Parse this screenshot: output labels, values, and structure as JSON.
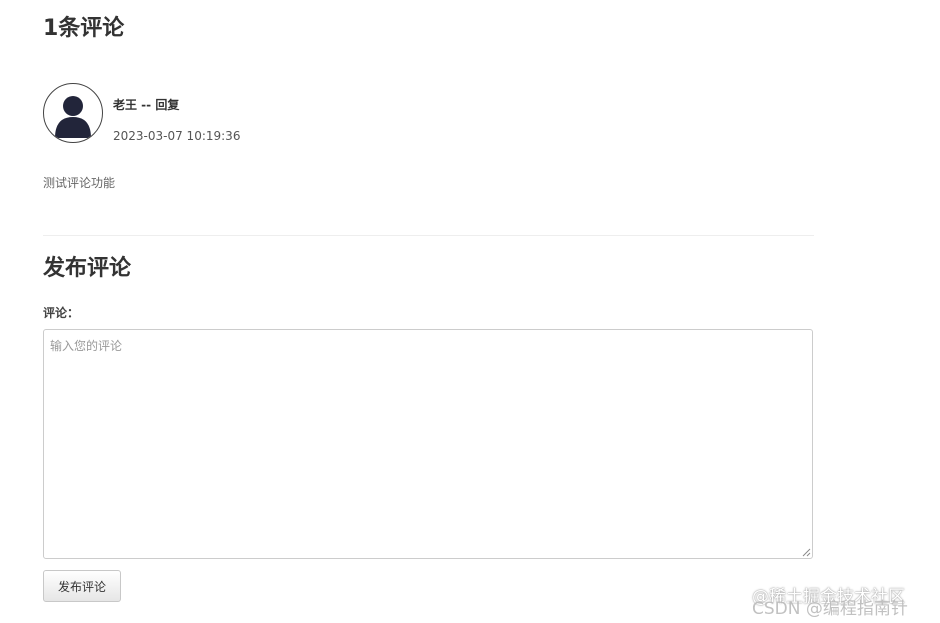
{
  "comments": {
    "count_title": "1条评论",
    "items": [
      {
        "author_line": "老王 -- 回复",
        "timestamp": "2023-03-07 10:19:36",
        "body": "测试评论功能",
        "avatar_icon": "default-user-avatar-icon"
      }
    ]
  },
  "post_form": {
    "title": "发布评论",
    "label": "评论：",
    "placeholder": "输入您的评论",
    "value": "",
    "submit_label": "发布评论"
  },
  "watermarks": {
    "primary": "@稀土掘金技术社区",
    "secondary": "CSDN @编程指南针"
  },
  "colors": {
    "text": "#333333",
    "muted": "#666666",
    "border": "#cccccc",
    "avatar_fill": "#22253a"
  }
}
